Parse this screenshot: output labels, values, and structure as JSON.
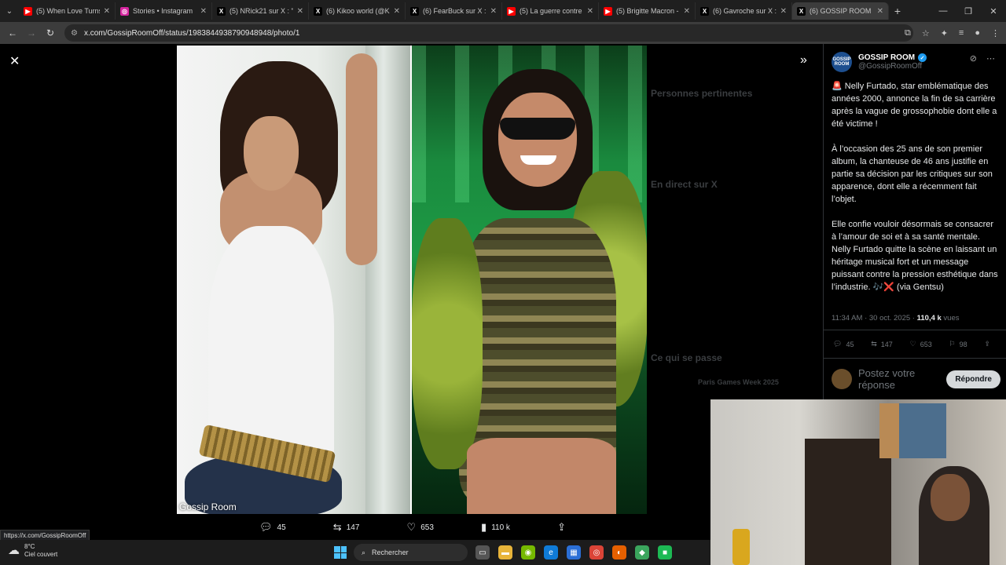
{
  "browser": {
    "tabs": [
      {
        "title": "(5) When Love Turns",
        "icon": "youtube-icon",
        "color": "#ff0000"
      },
      {
        "title": "Stories • Instagram",
        "icon": "instagram-icon",
        "color": "#d6249f"
      },
      {
        "title": "(5) NRick21 sur X : \"M",
        "icon": "x-icon",
        "color": "#000000"
      },
      {
        "title": "(6) Kikoo world (@Kik",
        "icon": "x-icon",
        "color": "#000000"
      },
      {
        "title": "(6) FearBuck sur X : \"",
        "icon": "x-icon",
        "color": "#000000"
      },
      {
        "title": "(5) La guerre contre l",
        "icon": "youtube-icon",
        "color": "#ff0000"
      },
      {
        "title": "(5) Brigitte Macron -",
        "icon": "youtube-icon",
        "color": "#ff0000"
      },
      {
        "title": "(6) Gavroche sur X : \"",
        "icon": "x-icon",
        "color": "#000000"
      },
      {
        "title": "(6) GOSSIP ROOM su",
        "icon": "x-icon",
        "color": "#000000",
        "active": true
      }
    ],
    "url": "x.com/GossipRoomOff/status/1983844938790948948/photo/1",
    "status_url": "https://x.com/GossipRoomOff"
  },
  "photo": {
    "watermark": "Gossip Room",
    "actions": {
      "replies": "45",
      "reposts": "147",
      "likes": "653",
      "views": "110 k"
    }
  },
  "background_page": {
    "relevant_people": "Personnes pertinentes",
    "live_on_x": "En direct sur X",
    "whats_happening": "Ce qui se passe",
    "event": "Paris Games Week 2025"
  },
  "tweet": {
    "author_name": "GOSSIP ROOM",
    "author_handle": "@GossipRoomOff",
    "avatar_text": "GOSSIP ROOM",
    "paragraphs": [
      "🚨 Nelly Furtado, star emblématique des années 2000, annonce la fin de sa carrière après la vague de grossophobie dont elle a été victime !",
      "À l’occasion des 25 ans de son premier album, la chanteuse de 46 ans justifie en partie sa décision par les critiques sur son apparence, dont elle a récemment fait l’objet.",
      "Elle confie vouloir désormais se consacrer à l’amour de soi et à sa santé mentale. Nelly Furtado quitte la scène en laissant un héritage musical fort et un message puissant contre la pression esthétique dans l’industrie. 🎶❌ (via Gentsu)"
    ],
    "time": "11:34 AM · 30 oct. 2025 · ",
    "views_count": "110,4 k",
    "views_label": " vues",
    "stats": {
      "replies": "45",
      "reposts": "147",
      "likes": "653",
      "bookmarks": "98"
    },
    "reply_placeholder": "Postez votre réponse",
    "reply_button": "Répondre"
  },
  "taskbar": {
    "temperature": "8°C",
    "weather": "Ciel couvert",
    "search": "Rechercher"
  }
}
